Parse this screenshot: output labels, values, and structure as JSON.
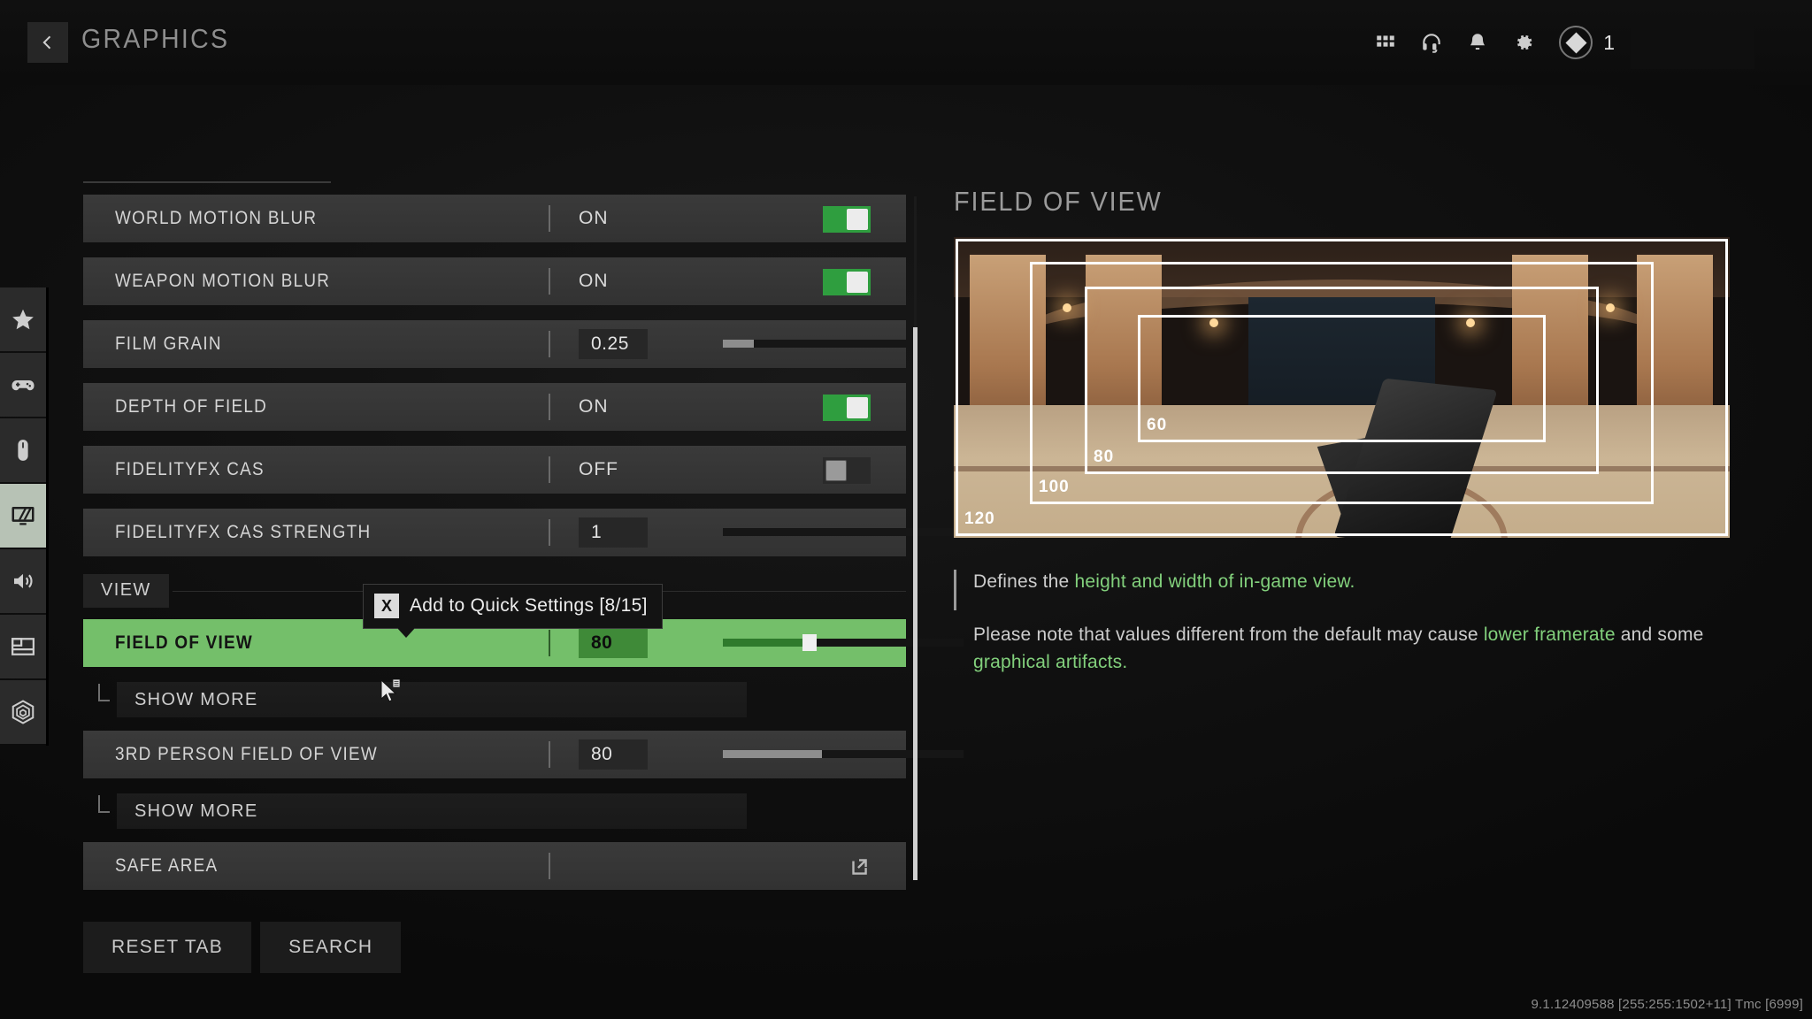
{
  "header": {
    "title": "GRAPHICS",
    "back_icon": "chevron-left-icon",
    "icons": [
      {
        "name": "grid-icon"
      },
      {
        "name": "headset-icon"
      },
      {
        "name": "bell-icon"
      },
      {
        "name": "gear-icon"
      }
    ],
    "currency": {
      "icon": "diamond-icon",
      "amount": "1"
    }
  },
  "sidebar": {
    "items": [
      {
        "name": "sidebar-item-favorites",
        "icon": "star-icon",
        "active": false
      },
      {
        "name": "sidebar-item-controller",
        "icon": "gamepad-icon",
        "active": false
      },
      {
        "name": "sidebar-item-mouse",
        "icon": "mouse-icon",
        "active": false
      },
      {
        "name": "sidebar-item-graphics",
        "icon": "monitor-icon",
        "active": true
      },
      {
        "name": "sidebar-item-audio",
        "icon": "speaker-icon",
        "active": false
      },
      {
        "name": "sidebar-item-interface",
        "icon": "layout-icon",
        "active": false
      },
      {
        "name": "sidebar-item-telemetry",
        "icon": "radar-icon",
        "active": false
      }
    ]
  },
  "settings": {
    "rows": [
      {
        "label": "WORLD MOTION BLUR",
        "value": "ON",
        "control": "toggle",
        "state": "on"
      },
      {
        "label": "WEAPON MOTION BLUR",
        "value": "ON",
        "control": "toggle",
        "state": "on"
      },
      {
        "label": "FILM GRAIN",
        "value": "0.25",
        "control": "slider",
        "fill_pct": 13
      },
      {
        "label": "DEPTH OF FIELD",
        "value": "ON",
        "control": "toggle",
        "state": "on"
      },
      {
        "label": "FIDELITYFX CAS",
        "value": "OFF",
        "control": "toggle",
        "state": "off"
      },
      {
        "label": "FIDELITYFX CAS STRENGTH",
        "value": "1",
        "control": "slider",
        "fill_pct": 0
      }
    ],
    "section_view": "VIEW",
    "field_of_view": {
      "label": "FIELD OF VIEW",
      "value": "80",
      "fill_pct": 36,
      "selected": true
    },
    "show_more_1": "SHOW MORE",
    "third_person": {
      "label": "3RD PERSON FIELD OF VIEW",
      "value": "80",
      "fill_pct": 41
    },
    "show_more_2": "SHOW MORE",
    "safe_area": {
      "label": "SAFE AREA",
      "icon": "external-link-icon"
    }
  },
  "tooltip": {
    "key": "X",
    "text": "Add to Quick Settings [8/15]"
  },
  "detail": {
    "title": "FIELD OF VIEW",
    "preview_labels": [
      "60",
      "80",
      "100",
      "120"
    ],
    "desc_line1_pre": "Defines the ",
    "desc_line1_hl": "height and width of in-game view.",
    "desc_line2_a": "Please note that values different from the default may cause ",
    "desc_line2_hl1": "lower framerate",
    "desc_line2_b": " and some ",
    "desc_line2_hl2": "graphical artifacts."
  },
  "bottom": {
    "reset_tab": "RESET TAB",
    "search": "SEARCH"
  },
  "version": "9.1.12409588 [255:255:1502+11] Tmc [6999]",
  "colors": {
    "accent_green": "#74bf6a",
    "toggle_on": "#2f9e3f",
    "text_highlight": "#82d07c"
  }
}
